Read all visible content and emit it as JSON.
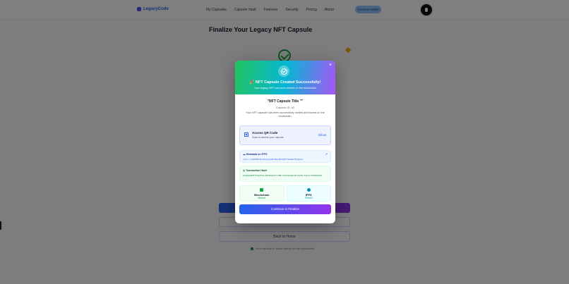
{
  "nav": {
    "logo": "LegacyCode",
    "links": [
      "My Capsules",
      "Capsule Vault",
      "Features",
      "Security",
      "Pricing",
      "About"
    ],
    "cta": "Connect Wallet"
  },
  "page": {
    "heading": "Finalize Your Legacy NFT Capsule",
    "back_button": "Back to Home",
    "footer_note": "Your capsule is safely stored on the blockchain"
  },
  "modal": {
    "title": "🎉 NFT Capsule Created Successfully!",
    "subtitle": "Your legacy NFT has been minted on the blockchain",
    "close": "×",
    "capsule_title": "\"NFT Capsule Title \"\"",
    "capsule_id": "Capsule ID: #2",
    "description": "Your NFT capsule has been successfully minted and stored on the blockchain.",
    "qr": {
      "label": "Access QR Code",
      "sub": "Scan to access your capsule",
      "action": "Show"
    },
    "ipfs": {
      "label": "Metadata on IPFS",
      "value": "ipfs://QmX8Bx4kLNrpQzyW5vMgc9HdqRfT2nWsK7Ej8pVa"
    },
    "tx": {
      "label": "Transaction Hash",
      "value": "0x4a9e8d5f7be37b1c26d0e5a7fc88c1bd7e2d4e70c9a3bcf1e1c7f6b8d2a5"
    },
    "stats": [
      {
        "name": "Blockchain",
        "value": "Minted"
      },
      {
        "name": "IPFS",
        "value": "Stored"
      }
    ],
    "continue_button": "Continue to Finalize"
  },
  "icons": {
    "success": "check-circle-icon",
    "qr": "qr-code-icon",
    "ipfs": "cloud-icon",
    "tx": "clock-icon",
    "external": "external-link-icon"
  },
  "colors": {
    "primary": "#2563eb",
    "accent": "#9333ea",
    "success": "#16a34a",
    "info": "#0891b2"
  }
}
